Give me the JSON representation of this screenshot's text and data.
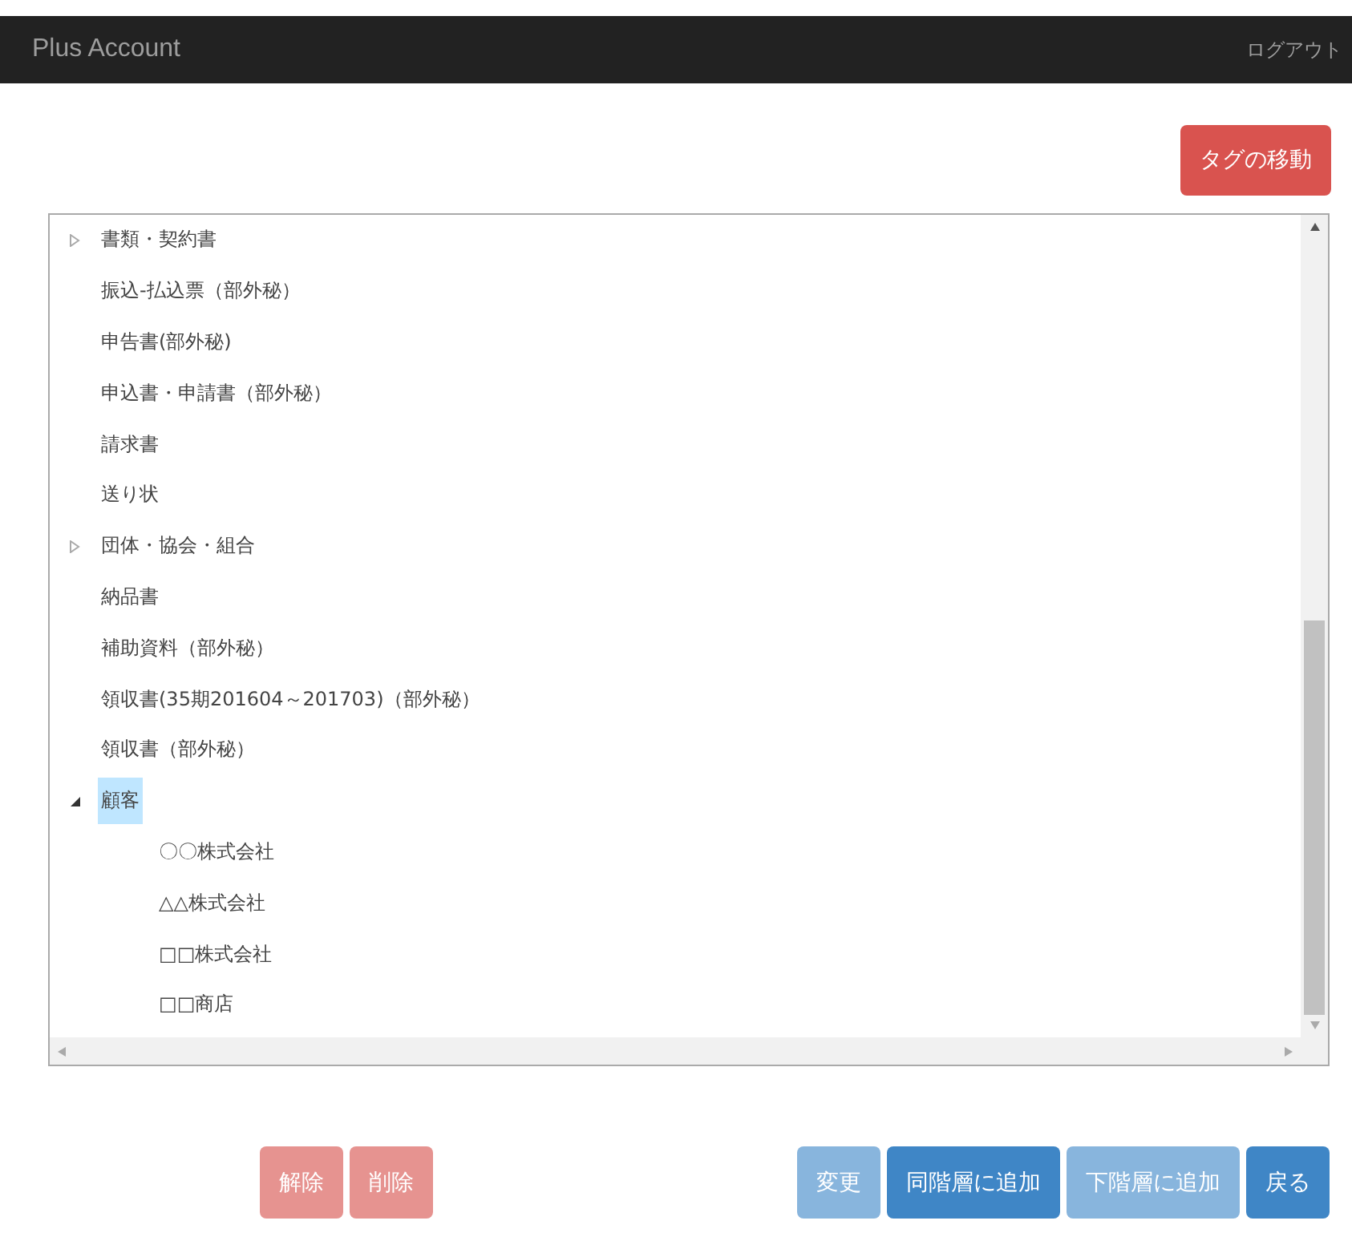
{
  "header": {
    "title": "Plus Account",
    "logout": "ログアウト"
  },
  "move_button": {
    "label": "タグの移動",
    "disabled": false
  },
  "tree": [
    {
      "label": "書類・契約書",
      "expanded": false,
      "selected": false
    },
    {
      "label": "振込-払込票（部外秘）",
      "selected": false
    },
    {
      "label": "申告書(部外秘)",
      "selected": false
    },
    {
      "label": "申込書・申請書（部外秘）",
      "selected": false
    },
    {
      "label": "請求書",
      "selected": false
    },
    {
      "label": "送り状",
      "selected": false
    },
    {
      "label": "団体・協会・組合",
      "expanded": false,
      "selected": false
    },
    {
      "label": "納品書",
      "selected": false
    },
    {
      "label": "補助資料（部外秘）",
      "selected": false
    },
    {
      "label": "領収書(35期201604～201703)（部外秘）",
      "selected": false
    },
    {
      "label": "領収書（部外秘）",
      "selected": false
    },
    {
      "label": "顧客",
      "expanded": true,
      "selected": true,
      "children": [
        {
          "label": "〇〇株式会社",
          "selected": false
        },
        {
          "label": "△△株式会社",
          "selected": false
        },
        {
          "label": "□□株式会社",
          "selected": false
        },
        {
          "label": "□□商店",
          "selected": false
        }
      ]
    }
  ],
  "buttons_left": [
    {
      "label": "解除",
      "kind": "danger",
      "disabled": true
    },
    {
      "label": "削除",
      "kind": "danger",
      "disabled": true
    }
  ],
  "buttons_right": [
    {
      "label": "変更",
      "kind": "primary",
      "disabled": true
    },
    {
      "label": "同階層に追加",
      "kind": "primary",
      "disabled": false
    },
    {
      "label": "下階層に追加",
      "kind": "primary",
      "disabled": true
    },
    {
      "label": "戻る",
      "kind": "primary",
      "disabled": false
    }
  ]
}
